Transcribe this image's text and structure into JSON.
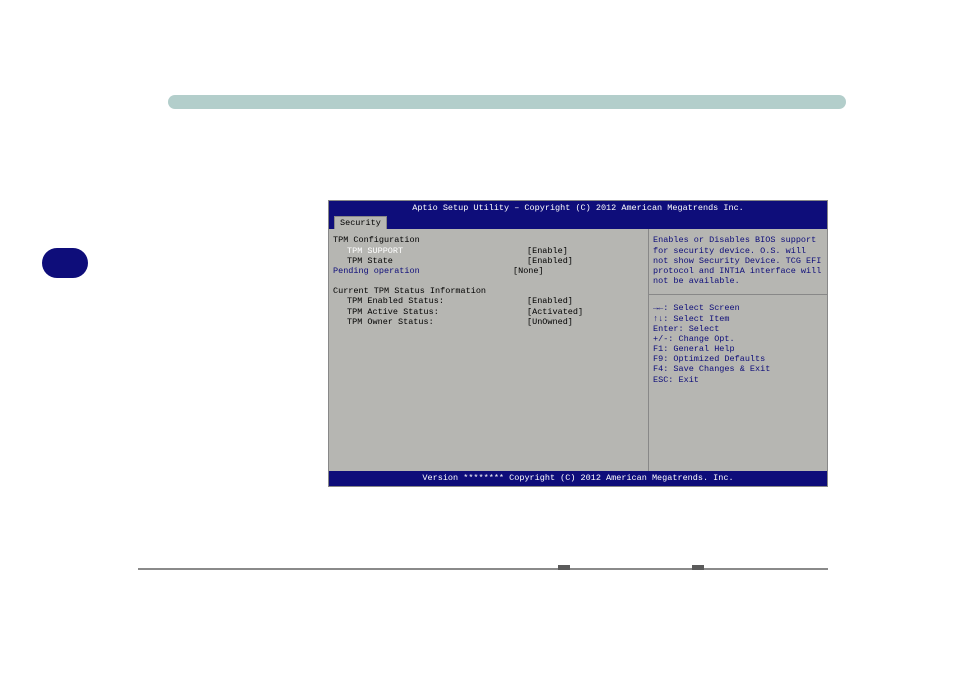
{
  "header": "Aptio Setup Utility – Copyright (C) 2012 American Megatrends Inc.",
  "tab": "Security",
  "section_title": "TPM Configuration",
  "rows": [
    {
      "label": "TPM SUPPORT",
      "value": "[Enable]",
      "selected": true,
      "indent": true
    },
    {
      "label": "TPM State",
      "value": "[Enabled]",
      "indent": true
    },
    {
      "label": "Pending operation",
      "value": "[None]",
      "pending": true
    }
  ],
  "status_title": "Current TPM Status Information",
  "status_rows": [
    {
      "label": "TPM Enabled Status:",
      "value": "[Enabled]"
    },
    {
      "label": "TPM Active Status:",
      "value": "[Activated]"
    },
    {
      "label": "TPM Owner Status:",
      "value": "[UnOwned]"
    }
  ],
  "help_text": "Enables or Disables BIOS support for security device. O.S. will not show Security Device. TCG EFI protocol and INT1A interface will not be available.",
  "nav": [
    "→←: Select Screen",
    "↑↓: Select Item",
    "Enter: Select",
    "+/-: Change Opt.",
    "F1: General Help",
    "F9: Optimized Defaults",
    "F4: Save Changes & Exit",
    "ESC: Exit"
  ],
  "footer": "Version ******** Copyright (C) 2012 American Megatrends. Inc."
}
